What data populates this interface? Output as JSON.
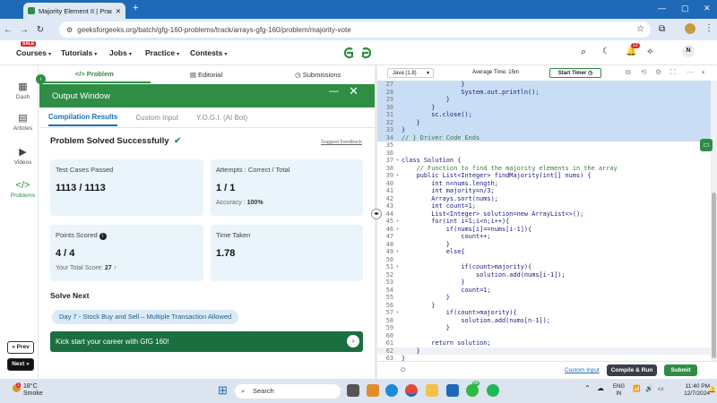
{
  "browser": {
    "tab_title": "Majority Element II | Practice | G",
    "url": "geeksforgeeks.org/batch/gfg-160-problems/track/arrays-gfg-160/problem/majority-vote"
  },
  "header": {
    "sale_badge": "SALE",
    "menu": [
      "Courses",
      "Tutorials",
      "Jobs",
      "Practice",
      "Contests"
    ],
    "logo": "GG",
    "notif_count": "13",
    "avatar": "N"
  },
  "rail": {
    "items": [
      "Dash",
      "Articles",
      "Videos",
      "Problems"
    ],
    "prev": "« Prev",
    "next": "Next »"
  },
  "problem_tabs": [
    "Problem",
    "Editorial",
    "Submissions"
  ],
  "output": {
    "title": "Output Window",
    "tabs": [
      "Compilation Results",
      "Custom Input",
      "Y.O.G.I. (AI Bot)"
    ],
    "status": "Problem Solved Successfully",
    "feedback": "Suggest Feedback",
    "cards": {
      "tests_label": "Test Cases Passed",
      "tests_value": "1113 / 1113",
      "attempts_label": "Attempts : Correct / Total",
      "attempts_value": "1 / 1",
      "accuracy_label": "Accuracy :",
      "accuracy_value": "100%",
      "points_label": "Points Scored",
      "points_value": "4 / 4",
      "total_label": "Your Total Score:",
      "total_value": "27",
      "time_label": "Time Taken",
      "time_value": "1.78"
    },
    "solve_next": "Solve Next",
    "next_chip": "Day 7 - Stock Buy and Sell – Multiple Transaction Allowed",
    "banner": "Kick start your career with GfG 160!"
  },
  "editor": {
    "language": "Java (1.8)",
    "avg_time": "Average Time: 15m",
    "timer": "Start Timer",
    "custom_input": "Custom Input",
    "compile": "Compile & Run",
    "submit": "Submit",
    "lines": [
      {
        "n": "27",
        "t": "                }",
        "sel": true
      },
      {
        "n": "28",
        "t": "                System.out.println();",
        "sel": true
      },
      {
        "n": "29",
        "t": "            }",
        "sel": true
      },
      {
        "n": "30",
        "t": "        }",
        "sel": true
      },
      {
        "n": "31",
        "t": "        sc.close();",
        "sel": true
      },
      {
        "n": "32",
        "t": "    }",
        "sel": true
      },
      {
        "n": "33",
        "t": "}",
        "sel": true
      },
      {
        "n": "34",
        "t": "// } Driver Code Ends",
        "sel": true,
        "cm": true
      },
      {
        "n": "35",
        "t": ""
      },
      {
        "n": "36",
        "t": ""
      },
      {
        "n": "37",
        "t": "class Solution {",
        "fold": true
      },
      {
        "n": "38",
        "t": "    // Function to find the majority elements in the array",
        "cm": true
      },
      {
        "n": "39",
        "t": "    public List<Integer> findMajority(int[] nums) {",
        "fold": true
      },
      {
        "n": "40",
        "t": "        int n=nums.length;"
      },
      {
        "n": "41",
        "t": "        int majority=n/3;"
      },
      {
        "n": "42",
        "t": "        Arrays.sort(nums);"
      },
      {
        "n": "43",
        "t": "        int count=1;"
      },
      {
        "n": "44",
        "t": "        List<Integer> solution=new ArrayList<>();"
      },
      {
        "n": "45",
        "t": "        for(int i=1;i<n;i++){",
        "fold": true
      },
      {
        "n": "46",
        "t": "            if(nums[i]==nums[i-1]){",
        "fold": true
      },
      {
        "n": "47",
        "t": "                count++;"
      },
      {
        "n": "48",
        "t": "            }"
      },
      {
        "n": "49",
        "t": "            else{",
        "fold": true
      },
      {
        "n": "50",
        "t": ""
      },
      {
        "n": "51",
        "t": "                if(count>majority){",
        "fold": true
      },
      {
        "n": "52",
        "t": "                    solution.add(nums[i-1]);"
      },
      {
        "n": "53",
        "t": "                }"
      },
      {
        "n": "54",
        "t": "                count=1;"
      },
      {
        "n": "55",
        "t": "            }"
      },
      {
        "n": "56",
        "t": "        }"
      },
      {
        "n": "57",
        "t": "            if(count>majority){",
        "fold": true
      },
      {
        "n": "58",
        "t": "                solution.add(nums[n-1]);"
      },
      {
        "n": "59",
        "t": "            }"
      },
      {
        "n": "60",
        "t": ""
      },
      {
        "n": "61",
        "t": "        return solution;"
      },
      {
        "n": "62",
        "t": "    }",
        "cur": true
      },
      {
        "n": "63",
        "t": "}"
      }
    ]
  },
  "taskbar": {
    "temp": "18°C",
    "weather": "Smoke",
    "search": "Search",
    "lang": "ENG",
    "region": "IN",
    "time": "11:40 PM",
    "date": "12/7/2024",
    "badge": "99"
  },
  "colors": {
    "green": "#2f8d46",
    "blue": "#1b6fb5",
    "selection": "#c9def4"
  }
}
